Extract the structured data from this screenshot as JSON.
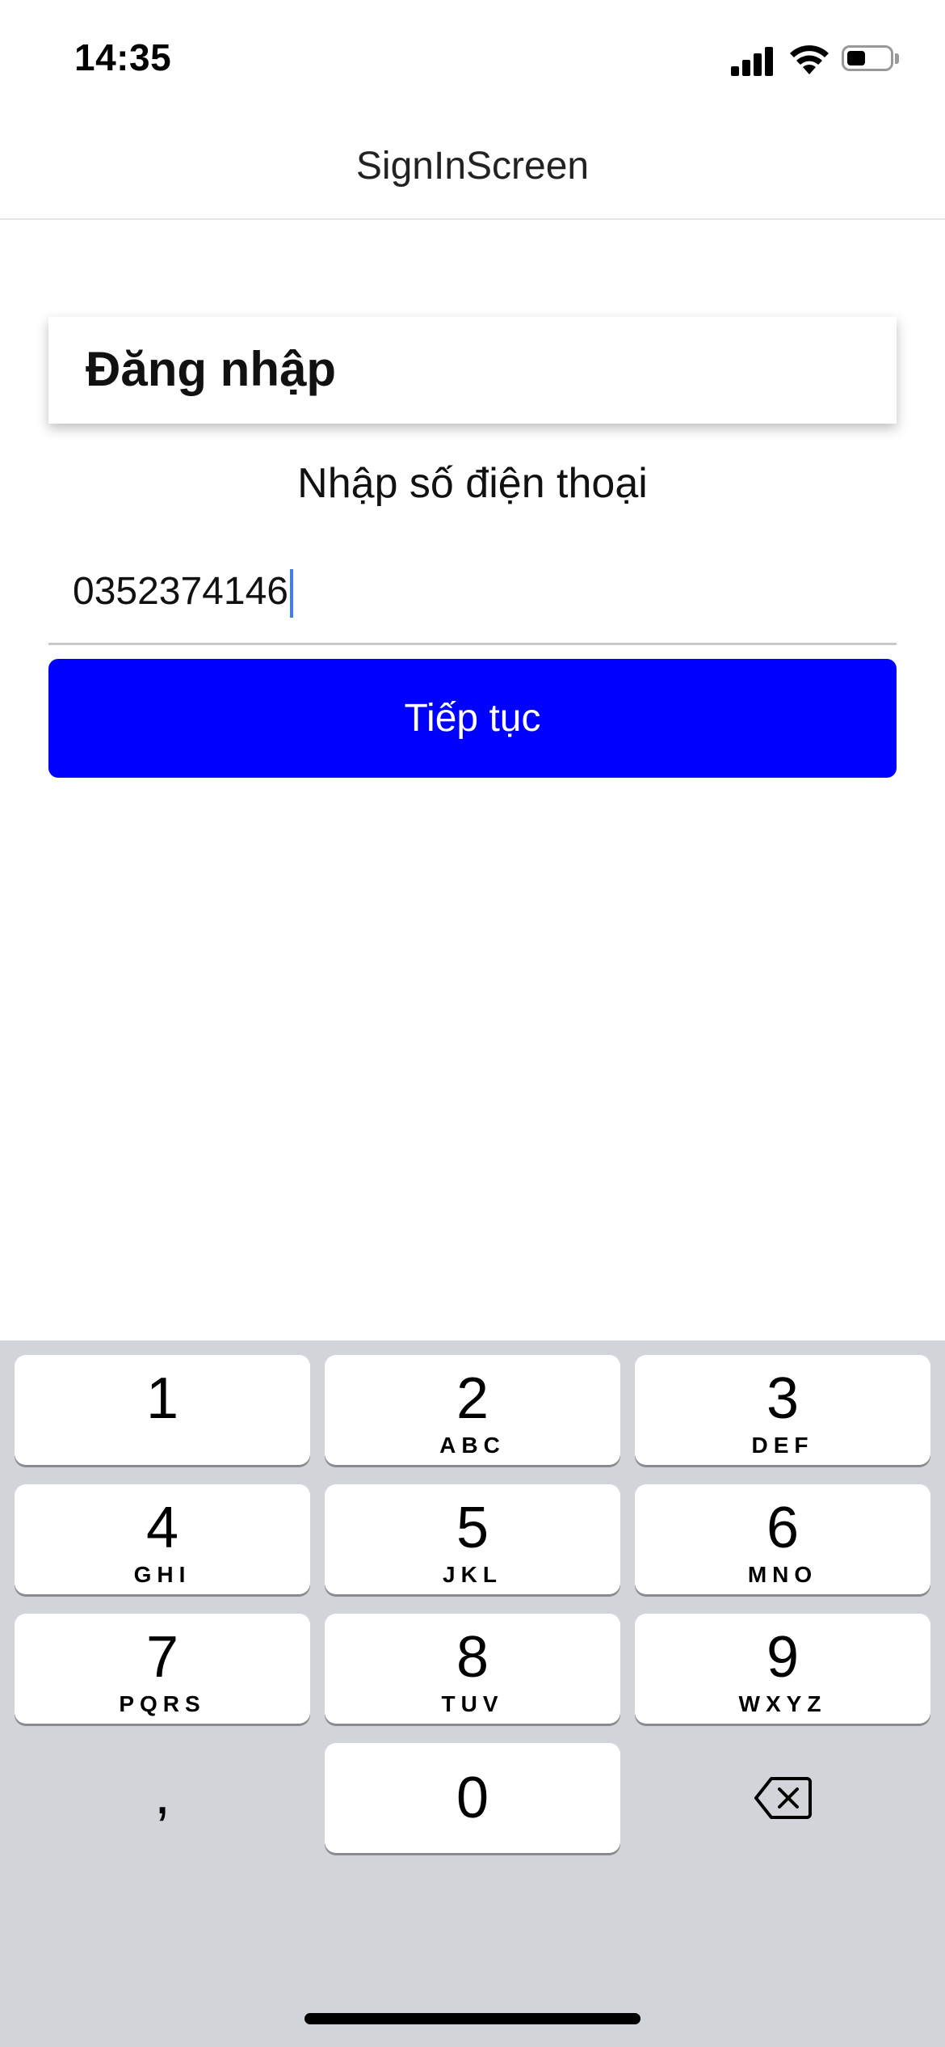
{
  "status_bar": {
    "time": "14:35"
  },
  "nav": {
    "title": "SignInScreen"
  },
  "card": {
    "title": "Đăng nhập"
  },
  "form": {
    "prompt": "Nhập số điện thoại",
    "phone_value": "0352374146",
    "continue_label": "Tiếp tục"
  },
  "colors": {
    "primary_button": "#0000ff",
    "keyboard_bg": "#d1d4d9",
    "caret": "#3f7cf5"
  },
  "keyboard": {
    "keys": [
      {
        "digit": "1",
        "letters": ""
      },
      {
        "digit": "2",
        "letters": "ABC"
      },
      {
        "digit": "3",
        "letters": "DEF"
      },
      {
        "digit": "4",
        "letters": "GHI"
      },
      {
        "digit": "5",
        "letters": "JKL"
      },
      {
        "digit": "6",
        "letters": "MNO"
      },
      {
        "digit": "7",
        "letters": "PQRS"
      },
      {
        "digit": "8",
        "letters": "TUV"
      },
      {
        "digit": "9",
        "letters": "WXYZ"
      },
      {
        "digit": "0",
        "letters": ""
      }
    ],
    "comma": ",",
    "delete_icon": "backspace-icon"
  }
}
